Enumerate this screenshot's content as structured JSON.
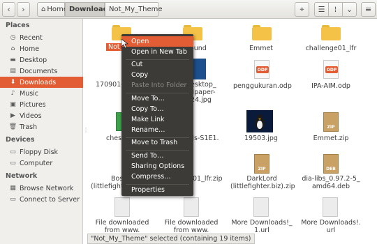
{
  "toolbar": {
    "back_icon": "chevron-left-icon",
    "forward_icon": "chevron-right-icon",
    "breadcrumbs": [
      {
        "label": "Home",
        "icon": "home-icon"
      },
      {
        "label": "Downloads"
      },
      {
        "label": "Not_My_Theme"
      }
    ]
  },
  "sidebar": {
    "sections": {
      "places": "Places",
      "devices": "Devices",
      "network": "Network"
    },
    "places": [
      {
        "label": "Recent",
        "icon": "clock-icon"
      },
      {
        "label": "Home",
        "icon": "home-icon"
      },
      {
        "label": "Desktop",
        "icon": "folder-icon"
      },
      {
        "label": "Documents",
        "icon": "document-icon"
      },
      {
        "label": "Downloads",
        "icon": "download-icon",
        "selected": true
      },
      {
        "label": "Music",
        "icon": "music-icon"
      },
      {
        "label": "Pictures",
        "icon": "picture-icon"
      },
      {
        "label": "Videos",
        "icon": "video-icon"
      },
      {
        "label": "Trash",
        "icon": "trash-icon"
      }
    ],
    "devices": [
      {
        "label": "Floppy Disk",
        "icon": "floppy-icon"
      },
      {
        "label": "Computer",
        "icon": "computer-icon"
      }
    ],
    "network": [
      {
        "label": "Browse Network",
        "icon": "network-icon"
      },
      {
        "label": "Connect to Server",
        "icon": "server-icon"
      }
    ]
  },
  "files": {
    "r1": [
      "Not_My_",
      "ground",
      "Emmet",
      "challenge01_lfr"
    ],
    "r2": [
      "170901-",
      "desktop_",
      "allpaper-",
      "024.jpg",
      "penggukuran.odp",
      "IPA-AIM.odp"
    ],
    "r3": [
      "ches",
      "ds-S1E1.",
      "19503.jpg",
      "Emmet.zip"
    ],
    "r4": [
      "Bos",
      "(littlefight",
      "01_lfr.zip",
      "DarkLord",
      "(littlefighter.biz).zip",
      "dia-libs_0.97.2-5_",
      "amd64.deb"
    ],
    "r5": [
      "File downloaded",
      "from www.",
      "File downloaded",
      "from www.",
      "More Downloads!_",
      "1.url",
      "More Downloads!.",
      "url"
    ],
    "badges": {
      "odp": "ODP",
      "zip": "ZIP",
      "deb": "DEB"
    }
  },
  "context_menu": {
    "items": [
      {
        "label": "Open",
        "highlighted": true
      },
      {
        "label": "Open in New Tab"
      },
      {
        "label": "Cut"
      },
      {
        "label": "Copy"
      },
      {
        "label": "Paste Into Folder",
        "disabled": true
      },
      {
        "label": "Move To…"
      },
      {
        "label": "Copy To…"
      },
      {
        "label": "Make Link"
      },
      {
        "label": "Rename…"
      },
      {
        "label": "Move to Trash"
      },
      {
        "label": "Send To…"
      },
      {
        "label": "Sharing Options"
      },
      {
        "label": "Compress…"
      },
      {
        "label": "Properties"
      }
    ]
  },
  "status": "\"Not_My_Theme\" selected (containing 19 items)",
  "colors": {
    "accent": "#e25d33",
    "menu_bg": "#3c3b37",
    "folder": "#f3c247",
    "odp": "#e25d33",
    "xls": "#3ea14b",
    "zip": "#c9a165"
  }
}
